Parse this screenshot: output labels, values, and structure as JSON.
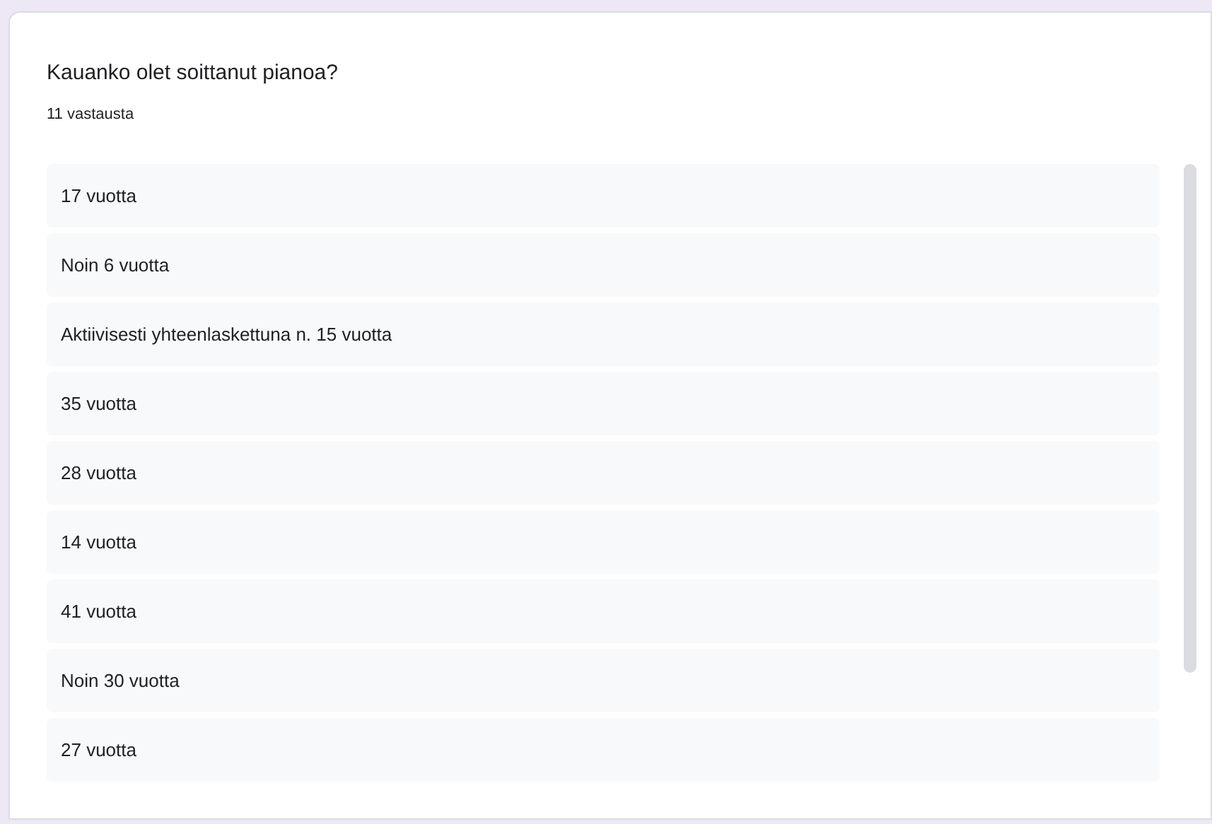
{
  "question": {
    "title": "Kauanko olet soittanut pianoa?",
    "count": "11 vastausta"
  },
  "responses": [
    "17 vuotta",
    "Noin 6 vuotta",
    "Aktiivisesti yhteenlaskettuna n. 15 vuotta",
    "35 vuotta",
    "28 vuotta",
    "14 vuotta",
    "41 vuotta",
    "Noin 30 vuotta",
    "27 vuotta"
  ]
}
